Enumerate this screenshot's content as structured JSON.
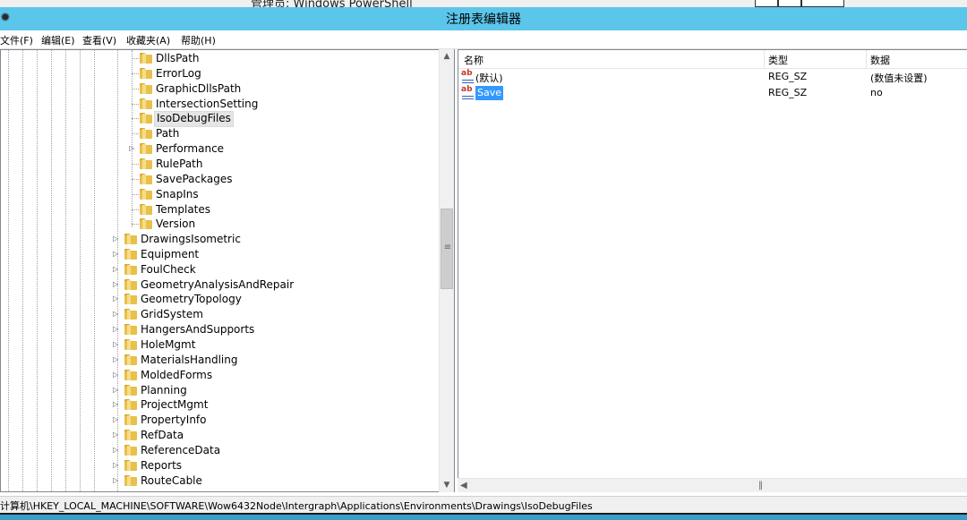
{
  "background_window": {
    "title": "管理员: Windows PowerShell"
  },
  "window": {
    "title": "注册表编辑器"
  },
  "menu": [
    "文件(F)",
    "编辑(E)",
    "查看(V)",
    "收藏夹(A)",
    "帮助(H)"
  ],
  "tree": {
    "subitems": [
      {
        "label": "DllsPath",
        "expandable": false
      },
      {
        "label": "ErrorLog",
        "expandable": false
      },
      {
        "label": "GraphicDllsPath",
        "expandable": false
      },
      {
        "label": "IntersectionSetting",
        "expandable": false
      },
      {
        "label": "IsoDebugFiles",
        "expandable": false,
        "selected": true
      },
      {
        "label": "Path",
        "expandable": false
      },
      {
        "label": "Performance",
        "expandable": true
      },
      {
        "label": "RulePath",
        "expandable": false
      },
      {
        "label": "SavePackages",
        "expandable": false
      },
      {
        "label": "SnapIns",
        "expandable": false
      },
      {
        "label": "Templates",
        "expandable": false
      },
      {
        "label": "Version",
        "expandable": false
      }
    ],
    "items": [
      {
        "label": "DrawingsIsometric",
        "expandable": true
      },
      {
        "label": "Equipment",
        "expandable": true
      },
      {
        "label": "FoulCheck",
        "expandable": true
      },
      {
        "label": "GeometryAnalysisAndRepair",
        "expandable": true
      },
      {
        "label": "GeometryTopology",
        "expandable": true
      },
      {
        "label": "GridSystem",
        "expandable": true
      },
      {
        "label": "HangersAndSupports",
        "expandable": true
      },
      {
        "label": "HoleMgmt",
        "expandable": true
      },
      {
        "label": "MaterialsHandling",
        "expandable": true
      },
      {
        "label": "MoldedForms",
        "expandable": true
      },
      {
        "label": "Planning",
        "expandable": true
      },
      {
        "label": "ProjectMgmt",
        "expandable": true
      },
      {
        "label": "PropertyInfo",
        "expandable": true
      },
      {
        "label": "RefData",
        "expandable": true
      },
      {
        "label": "ReferenceData",
        "expandable": true
      },
      {
        "label": "Reports",
        "expandable": true
      },
      {
        "label": "RouteCable",
        "expandable": true
      }
    ]
  },
  "list": {
    "columns": [
      "名称",
      "类型",
      "数据"
    ],
    "rows": [
      {
        "name": "(默认)",
        "type": "REG_SZ",
        "data": "(数值未设置)",
        "selected": false
      },
      {
        "name": "Save",
        "type": "REG_SZ",
        "data": "no",
        "selected": true
      }
    ]
  },
  "status": {
    "path": "计算机\\HKEY_LOCAL_MACHINE\\SOFTWARE\\Wow6432Node\\Intergraph\\Applications\\Environments\\Drawings\\IsoDebugFiles"
  },
  "colors": {
    "titlebar": "#5bc6ea",
    "selection": "#3399ff",
    "folder": "#e8c04a"
  }
}
